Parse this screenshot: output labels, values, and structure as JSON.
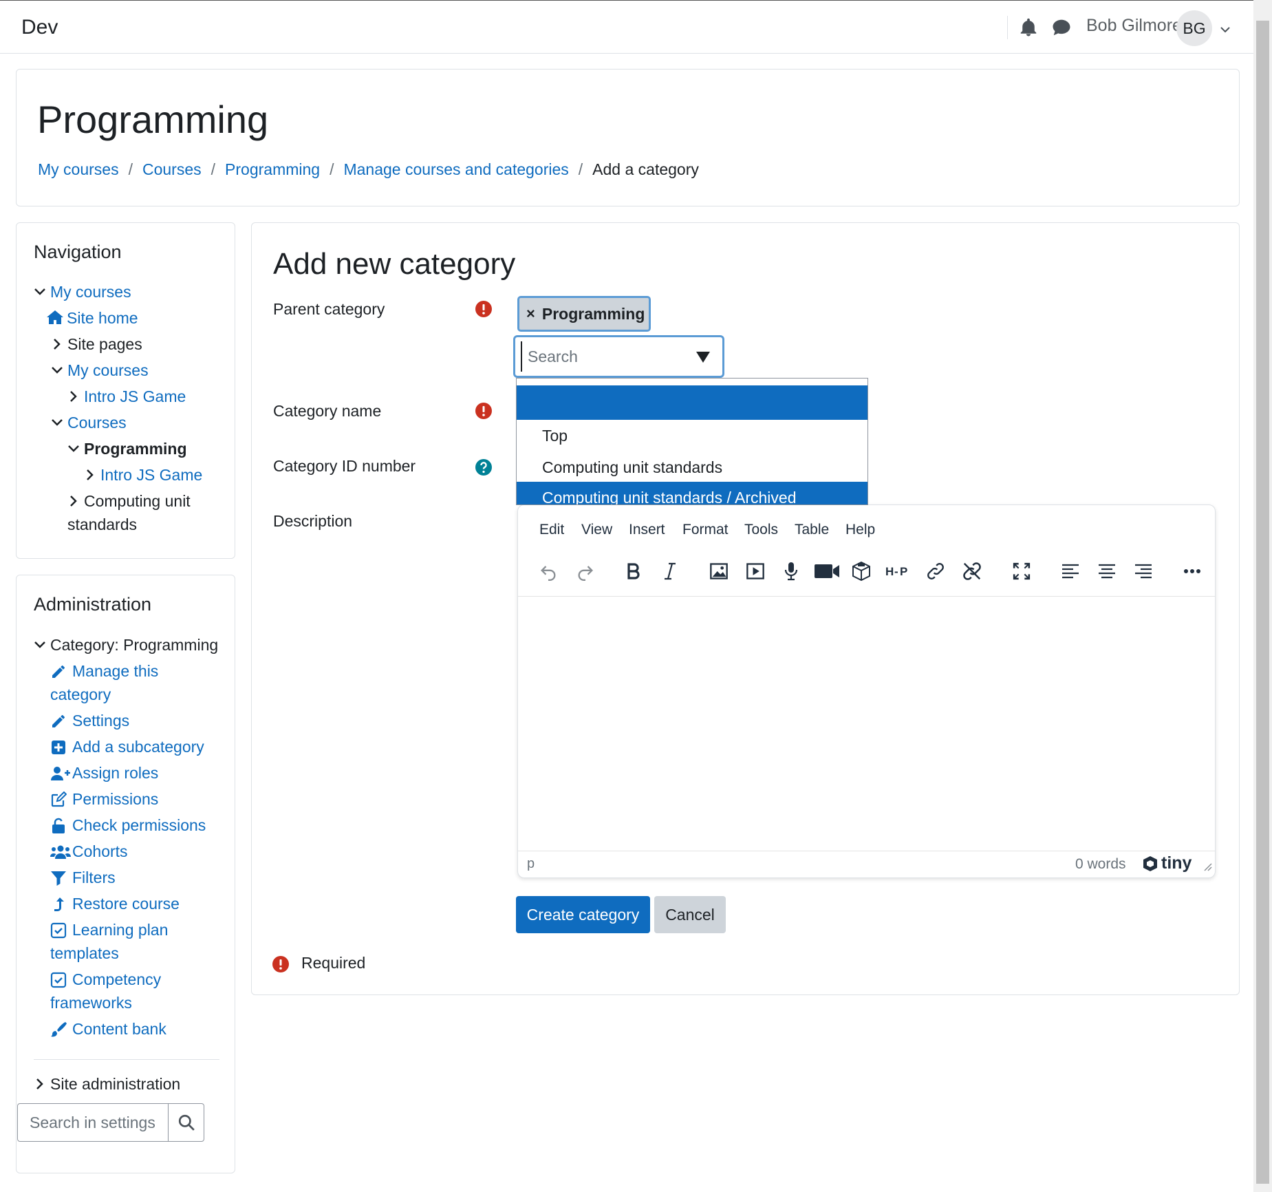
{
  "navbar": {
    "brand": "Dev",
    "user_name": "Bob Gilmore",
    "user_initials": "BG"
  },
  "header": {
    "title": "Programming",
    "breadcrumb": [
      "My courses",
      "Courses",
      "Programming",
      "Manage courses and categories",
      "Add a category"
    ]
  },
  "navigation": {
    "title": "Navigation",
    "items": [
      {
        "label": "My courses",
        "state": "expanded",
        "link": true
      },
      {
        "label": "Site home",
        "icon": "home-icon",
        "link": true
      },
      {
        "label": "Site pages",
        "state": "collapsed",
        "link": false
      },
      {
        "label": "My courses",
        "state": "expanded",
        "link": true
      },
      {
        "label": "Intro JS Game",
        "state": "collapsed",
        "link": true
      },
      {
        "label": "Courses",
        "state": "expanded",
        "link": true
      },
      {
        "label": "Programming",
        "state": "expanded",
        "link": false,
        "bold": true
      },
      {
        "label": "Intro JS Game",
        "state": "collapsed",
        "link": true
      },
      {
        "label": "Computing unit",
        "label_line2": "standards",
        "state": "collapsed",
        "link": false
      }
    ]
  },
  "administration": {
    "title": "Administration",
    "category_label": "Category: Programming",
    "items": [
      {
        "label": "Manage this",
        "label_line2": "category",
        "icon": "pencil-icon"
      },
      {
        "label": "Settings",
        "icon": "pencil-icon"
      },
      {
        "label": "Add a subcategory",
        "icon": "plus-square-icon"
      },
      {
        "label": "Assign roles",
        "icon": "user-plus-icon"
      },
      {
        "label": "Permissions",
        "icon": "edit-icon"
      },
      {
        "label": "Check permissions",
        "icon": "unlock-icon"
      },
      {
        "label": "Cohorts",
        "icon": "users-icon"
      },
      {
        "label": "Filters",
        "icon": "filter-icon"
      },
      {
        "label": "Restore course",
        "icon": "upload-icon"
      },
      {
        "label": "Learning plan",
        "label_line2": "templates",
        "icon": "check-square-icon"
      },
      {
        "label": "Competency",
        "label_line2": "frameworks",
        "icon": "check-square-icon"
      },
      {
        "label": "Content bank",
        "icon": "paint-brush-icon"
      }
    ],
    "site_admin_label": "Site administration",
    "search_placeholder": "Search in settings"
  },
  "form": {
    "title": "Add new category",
    "parent_category_label": "Parent category",
    "parent_selected": "Programming",
    "search_placeholder": "Search",
    "dropdown_options": [
      "",
      "Top",
      "Computing unit standards",
      "Computing unit standards / Archived"
    ],
    "dropdown_selected_index": 3,
    "category_name_label": "Category name",
    "category_id_label": "Category ID number",
    "description_label": "Description",
    "editor": {
      "menu": [
        "Edit",
        "View",
        "Insert",
        "Format",
        "Tools",
        "Table",
        "Help"
      ],
      "status_path": "p",
      "word_count": "0 words",
      "logo_text": "tiny"
    },
    "create_button": "Create category",
    "cancel_button": "Cancel",
    "required_note": "Required"
  },
  "colors": {
    "link": "#0f6cbf",
    "primary": "#0f6cbf",
    "required": "#ca3120",
    "help": "#008196"
  }
}
